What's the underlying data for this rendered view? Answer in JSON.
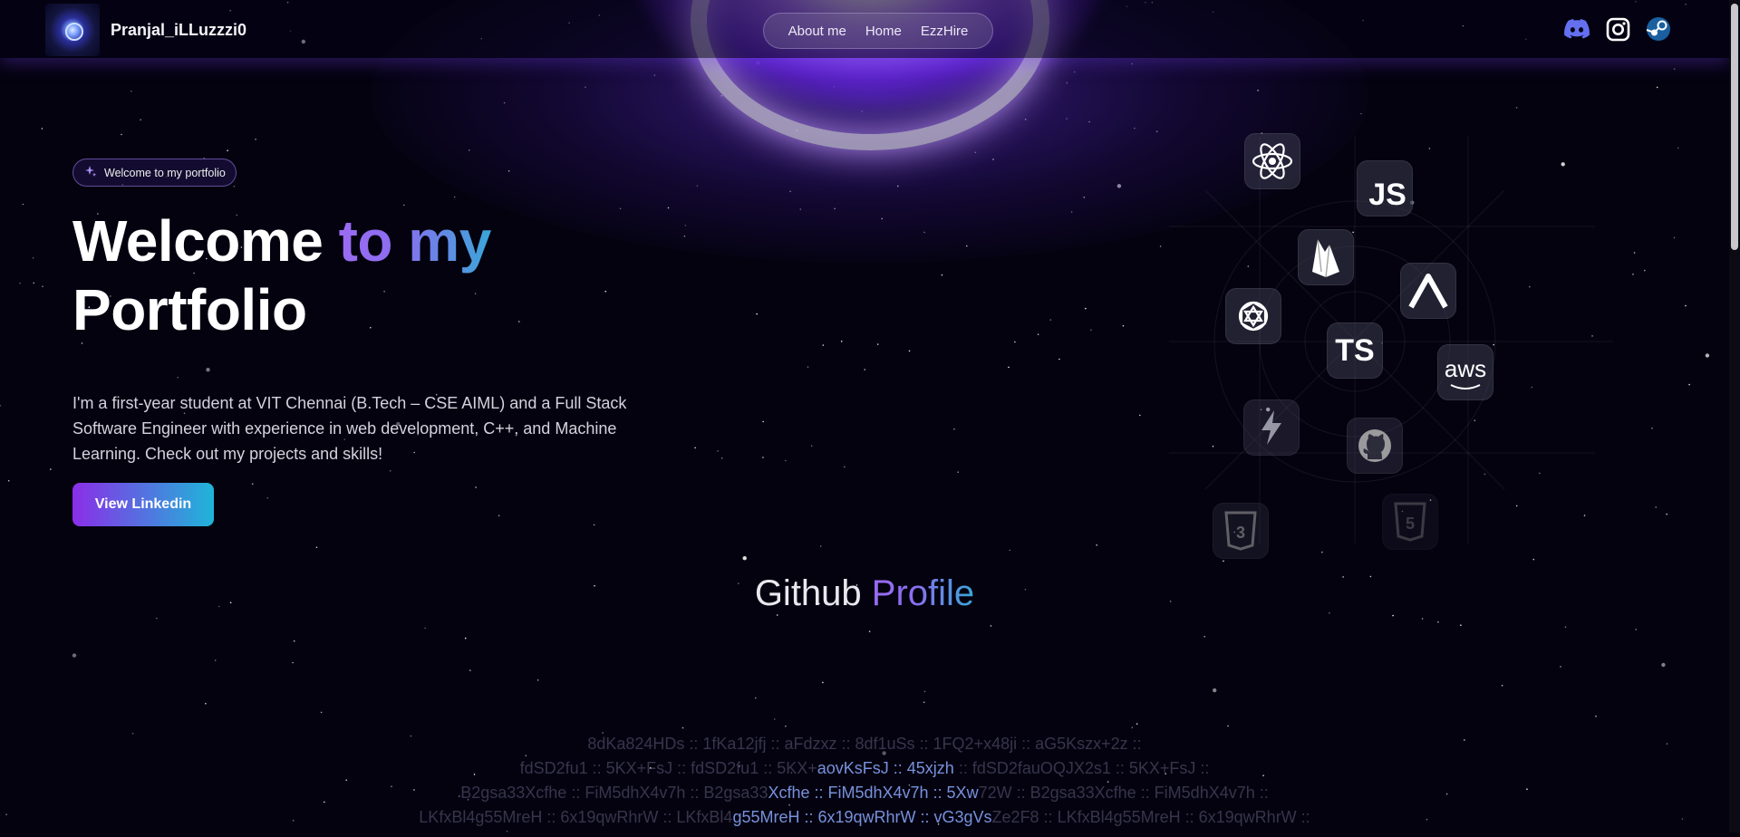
{
  "header": {
    "brand_name": "Pranjal_iLLuzzzi0",
    "nav": [
      "About me",
      "Home",
      "EzzHire"
    ],
    "socials": [
      "discord-icon",
      "instagram-icon",
      "steam-icon"
    ]
  },
  "hero": {
    "badge": "Welcome to my portfolio",
    "title_part1": "Welcome ",
    "title_highlight": "to my",
    "title_part2": "Portfolio",
    "intro": "I'm a first-year student at VIT Chennai (B.Tech – CSE AIML) and a Full Stack Software Engineer with experience in web development, C++, and Machine Learning. Check out my projects and skills!",
    "cta": "View Linkedin"
  },
  "skills": {
    "js": "JS",
    "ts": "TS",
    "aws": "aws",
    "icons": [
      "react-icon",
      "javascript-icon",
      "firebase-icon",
      "vercel-icon",
      "openai-icon",
      "typescript-icon",
      "aws-icon",
      "vite-icon",
      "github-icon",
      "css3-icon",
      "html5-icon"
    ]
  },
  "github": {
    "title_part1": "Github ",
    "title_highlight": "Profile"
  },
  "hash_lines": [
    {
      "dim1": "8dKa824HDs :: 1fKa12jfj :: aFdzxz :: 8df1uSs :: 1FQ2+x48ji :: aG5Kszx+2z ::"
    },
    {
      "dim1": "fdSD2fu1 :: 5KX+FsJ :: fdSD2fu1 :: 5KX+",
      "hl": "aovKsFsJ :: 45xjzh",
      "dim2": " :: fdSD2fauOQJX2s1 :: 5KX+FsJ ::"
    },
    {
      "dim1": "B2gsa33Xcfhe :: FiM5dhX4v7h :: B2gsa33",
      "hl": "Xcfhe :: FiM5dhX4v7h :: 5Xw",
      "dim2": "72W :: B2gsa33Xcfhe :: FiM5dhX4v7h ::"
    },
    {
      "dim1": "LKfxBl4g55MreH :: 6x19qwRhrW :: LKfxBl4",
      "hl": "g55MreH :: 6x19qwRhrW :: vG3gVs",
      "dim2": "Ze2F8 :: LKfxBl4g55MreH :: 6x19qwRhrW ::"
    }
  ]
}
